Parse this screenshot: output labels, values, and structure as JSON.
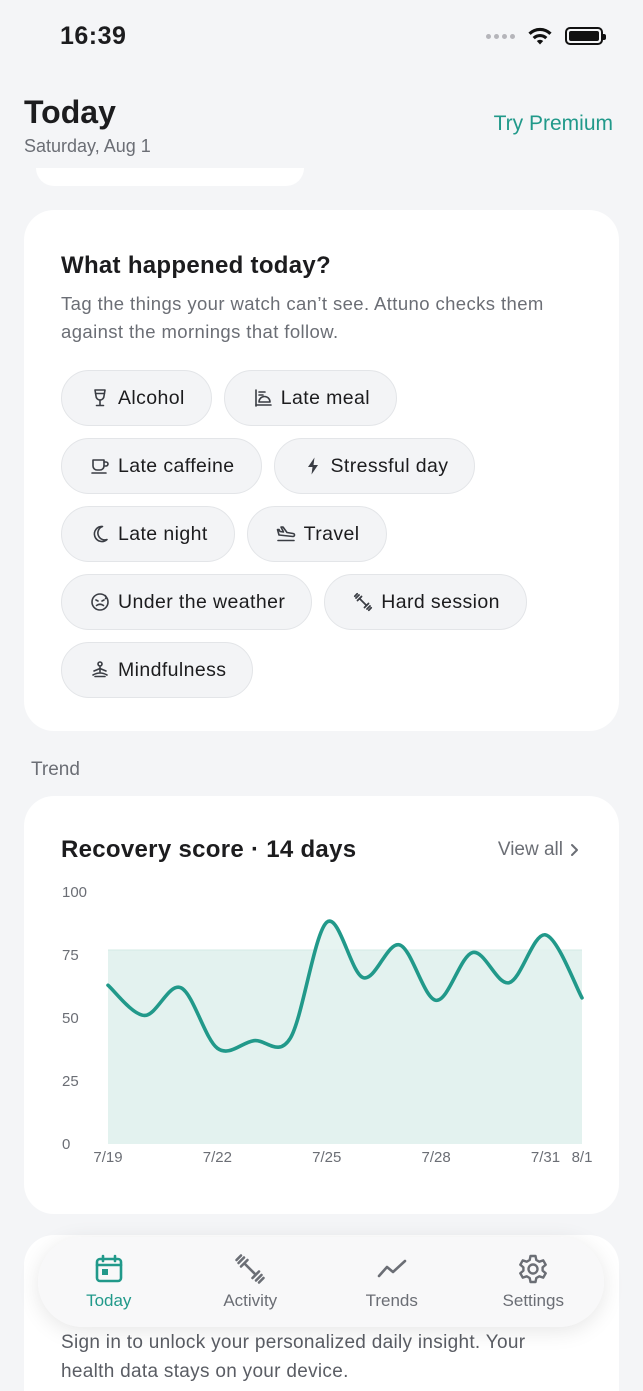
{
  "status_bar": {
    "time": "16:39"
  },
  "header": {
    "title": "Today",
    "date": "Saturday, Aug 1",
    "premium_label": "Try Premium"
  },
  "tags_card": {
    "title": "What happened today?",
    "description": "Tag the things your watch can’t see. Attuno checks them against the mornings that follow.",
    "tags": [
      {
        "label": "Alcohol",
        "icon": "wine-glass-icon"
      },
      {
        "label": "Late meal",
        "icon": "meal-icon"
      },
      {
        "label": "Late caffeine",
        "icon": "coffee-cup-icon"
      },
      {
        "label": "Stressful day",
        "icon": "bolt-icon"
      },
      {
        "label": "Late night",
        "icon": "moon-icon"
      },
      {
        "label": "Travel",
        "icon": "airplane-icon"
      },
      {
        "label": "Under the weather",
        "icon": "sick-face-icon"
      },
      {
        "label": "Hard session",
        "icon": "dumbbell-icon"
      },
      {
        "label": "Mindfulness",
        "icon": "meditation-icon"
      }
    ]
  },
  "trend_section": {
    "label": "Trend"
  },
  "trend_card": {
    "view_all": "View all"
  },
  "chart_data": {
    "type": "line",
    "title": "Recovery score · 14 days",
    "xlabel": "",
    "ylabel": "",
    "ylim": [
      0,
      100
    ],
    "yticks": [
      0,
      25,
      50,
      75,
      100
    ],
    "x": [
      "7/19",
      "7/20",
      "7/21",
      "7/22",
      "7/23",
      "7/24",
      "7/25",
      "7/26",
      "7/27",
      "7/28",
      "7/29",
      "7/30",
      "7/31",
      "8/1"
    ],
    "xtick_labels": [
      "7/19",
      "7/22",
      "7/25",
      "7/28",
      "7/31",
      "8/1"
    ],
    "values": [
      63,
      51,
      62,
      38,
      41,
      42,
      88,
      66,
      79,
      57,
      76,
      64,
      83,
      58
    ],
    "band": [
      0,
      77
    ],
    "line_color": "#21998a",
    "fill_color": "#e3f2ef",
    "grid": false
  },
  "tabbar": {
    "tabs": [
      {
        "label": "Today",
        "icon": "calendar-icon",
        "active": true
      },
      {
        "label": "Activity",
        "icon": "dumbbell-icon",
        "active": false
      },
      {
        "label": "Trends",
        "icon": "trend-line-icon",
        "active": false
      },
      {
        "label": "Settings",
        "icon": "gear-icon",
        "active": false
      }
    ]
  },
  "footer": {
    "signin_text": "Sign in to unlock your personalized daily insight. Your health data stays on your device."
  },
  "colors": {
    "accent": "#21998a",
    "background": "#f4f5f7",
    "card": "#ffffff",
    "muted_text": "#6b6e75"
  }
}
